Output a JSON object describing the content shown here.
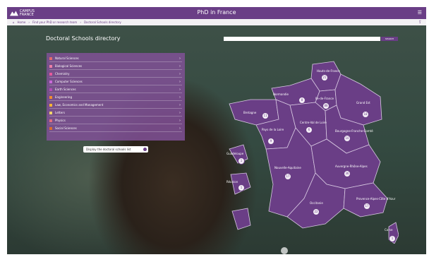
{
  "header": {
    "logo_text": "CAMPUS FRANCE",
    "title": "PhD in France",
    "menu_icon": "hamburger-icon"
  },
  "breadcrumb": {
    "items": [
      "Home",
      "Find your PhD or research team",
      "Doctoral Schools directory"
    ],
    "right_icon": "share-icon"
  },
  "directory": {
    "title": "Doctoral Schools directory"
  },
  "search": {
    "placeholder": "",
    "button_label": "SEARCH"
  },
  "filters": {
    "items": [
      {
        "label": "Natural Sciences",
        "color": "#e46c6c"
      },
      {
        "label": "Biological Sciences",
        "color": "#ec7ea6"
      },
      {
        "label": "Chemistry",
        "color": "#e55a9b"
      },
      {
        "label": "Computer Sciences",
        "color": "#c86ad8"
      },
      {
        "label": "Earth Sciences",
        "color": "#b14fb5"
      },
      {
        "label": "Engineering",
        "color": "#f08c2d"
      },
      {
        "label": "Law, Economics and Management",
        "color": "#f5b334"
      },
      {
        "label": "Letters",
        "color": "#f0d36a"
      },
      {
        "label": "Physics",
        "color": "#df6f80"
      },
      {
        "label": "Social Sciences",
        "color": "#d96d2e"
      }
    ]
  },
  "tooltip": {
    "text": "Display the doctoral schools list"
  },
  "map": {
    "regions": [
      {
        "label": "Hauts-de-France",
        "count": "21"
      },
      {
        "label": "Normandie",
        "count": "8"
      },
      {
        "label": "Ile-de-France",
        "count": "88"
      },
      {
        "label": "Grand Est",
        "count": "18"
      },
      {
        "label": "Bretagne",
        "count": "11"
      },
      {
        "label": "Pays de la Loire",
        "count": "9"
      },
      {
        "label": "Centre-Val de Loire",
        "count": "6"
      },
      {
        "label": "Bourgogne-Franche-Comté",
        "count": "10"
      },
      {
        "label": "Nouvelle-Aquitaine",
        "count": "17"
      },
      {
        "label": "Auvergne-Rhône-Alpes",
        "count": "36"
      },
      {
        "label": "Occitanie",
        "count": "22"
      },
      {
        "label": "Provence-Alpes-Côte d'Azur",
        "count": "17"
      },
      {
        "label": "Corse",
        "count": "1"
      },
      {
        "label": "Guadeloupe",
        "count": "1"
      },
      {
        "label": "Réunion",
        "count": "1"
      }
    ]
  },
  "colors": {
    "brand": "#6a3e86",
    "region_fill": "#6a3e86",
    "region_border": "#d8c9e2"
  }
}
